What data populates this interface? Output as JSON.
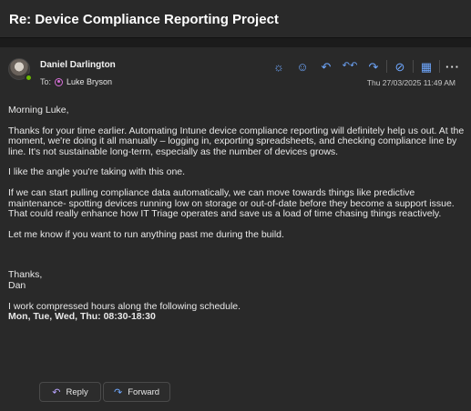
{
  "subject": "Re: Device Compliance Reporting Project",
  "message": {
    "sender": "Daniel Darlington",
    "to_label": "To:",
    "recipient": "Luke Bryson",
    "date": "Thu 27/03/2025 11:49 AM"
  },
  "toolbar": {
    "icons": [
      "sun-icon",
      "emoji-icon",
      "reply-icon",
      "reply-all-icon",
      "forward-icon",
      "loop-icon",
      "apps-grid-icon",
      "more-options-icon"
    ],
    "sun": "☼",
    "emoji": "☺",
    "reply": "↶",
    "reply_all": "↶↶",
    "forward": "↷",
    "loop": "⊘",
    "apps": "▦",
    "more": "···"
  },
  "body": {
    "greeting": "Morning Luke,",
    "paragraph1": "Thanks for your time earlier. Automating Intune device compliance reporting will definitely help us out. At the moment, we're doing it all manually – logging in, exporting spreadsheets, and checking compliance line by line. It's not sustainable long-term, especially as the number of devices grows.",
    "paragraph2": "I like the angle you're taking with this one.",
    "paragraph3": "If we can start pulling compliance data automatically, we can move towards things like predictive maintenance- spotting devices running low on storage or out-of-date before they become a support issue. That could really enhance how IT Triage operates and save us a load of time chasing things reactively.",
    "paragraph4": "Let me know if you want to run anything past me during the build.",
    "signoff": "Thanks,",
    "signature": "Dan",
    "schedule_intro": "I work compressed hours along the following schedule.",
    "schedule": "Mon, Tue, Wed, Thu: 08:30-18:30"
  },
  "actions": {
    "reply_label": "Reply",
    "forward_label": "Forward",
    "reply_icon": "↶",
    "forward_icon": "↷"
  }
}
